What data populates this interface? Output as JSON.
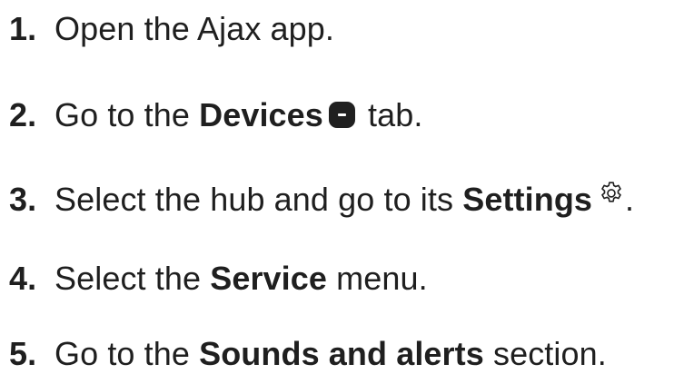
{
  "steps": [
    {
      "number": "1.",
      "before": "Open the Ajax app.",
      "bold": "",
      "after": ""
    },
    {
      "number": "2.",
      "before": "Go to the ",
      "bold": "Devices",
      "after": " tab.",
      "icon": "devices-tab-icon"
    },
    {
      "number": "3.",
      "before": "Select the hub and go to its ",
      "bold": "Settings",
      "after": ".",
      "icon": "gear-icon"
    },
    {
      "number": "4.",
      "before": "Select the ",
      "bold": "Service",
      "after": " menu."
    },
    {
      "number": "5.",
      "before": "Go to the ",
      "bold": "Sounds and alerts",
      "after": " section."
    }
  ]
}
